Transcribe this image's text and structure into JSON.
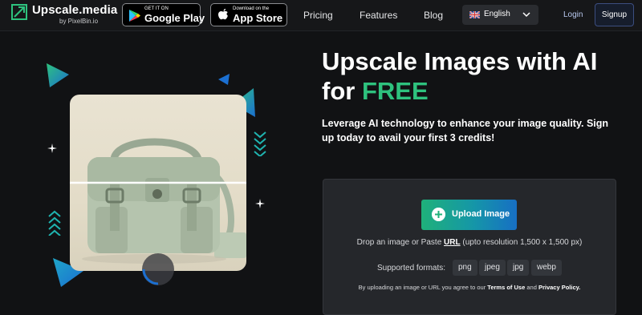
{
  "nav": {
    "logo_name": "Upscale.media",
    "logo_sub": "by PixelBin.io",
    "google_play": {
      "small": "GET IT ON",
      "big": "Google Play"
    },
    "app_store": {
      "small": "Download on the",
      "big": "App Store"
    },
    "links": [
      "Pricing",
      "Features",
      "Blog"
    ],
    "language": "English",
    "login": "Login",
    "signup": "Signup"
  },
  "hero": {
    "title_line1": "Upscale Images with AI",
    "title_line2_prefix": "for ",
    "title_free": "FREE",
    "lead": "Leverage AI technology to enhance your image quality. Sign up today to avail your first 3 credits!"
  },
  "upload": {
    "button_label": "Upload Image",
    "drop_prefix": "Drop an image or Paste ",
    "drop_url": "URL",
    "drop_suffix": " (upto resolution 1,500 x 1,500 px)",
    "formats_label": "Supported formats:",
    "formats": [
      "png",
      "jpeg",
      "jpg",
      "webp"
    ],
    "terms_prefix": "By uploading an image or URL you agree to our ",
    "terms_link": "Terms of Use",
    "terms_and": " and ",
    "privacy_link": "Privacy Policy."
  },
  "colors": {
    "accent_green": "#2ec27e",
    "accent_blue": "#176fc4",
    "background": "#111214"
  },
  "icons": [
    "logo-icon",
    "google-play-icon",
    "apple-icon",
    "uk-flag-icon",
    "chevron-down-icon",
    "plus-icon"
  ]
}
